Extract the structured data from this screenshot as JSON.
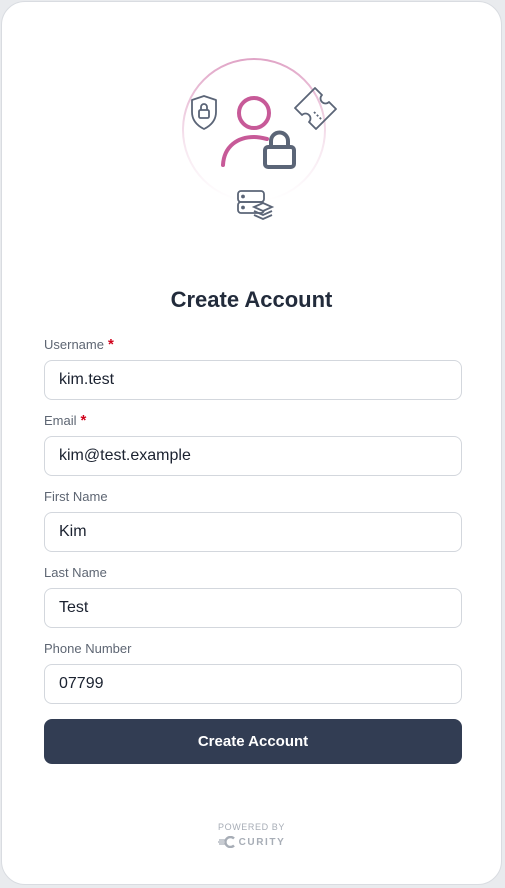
{
  "header": {
    "title": "Create Account"
  },
  "icons": [
    "shield-lock-icon",
    "user-lock-icon",
    "ticket-icon",
    "server-stack-icon"
  ],
  "colors": {
    "accent": "#c75a98",
    "button": "#323d53",
    "required": "#d0021b"
  },
  "form": {
    "fields": [
      {
        "label": "Username",
        "required_mark": "*",
        "value": "kim.test"
      },
      {
        "label": "Email",
        "required_mark": "*",
        "value": "kim@test.example"
      },
      {
        "label": "First Name",
        "value": "Kim"
      },
      {
        "label": "Last Name",
        "value": "Test"
      },
      {
        "label": "Phone Number",
        "value": "07799"
      }
    ],
    "submit_label": "Create Account"
  },
  "footer": {
    "powered_by": "POWERED BY",
    "brand": "CURITY"
  }
}
